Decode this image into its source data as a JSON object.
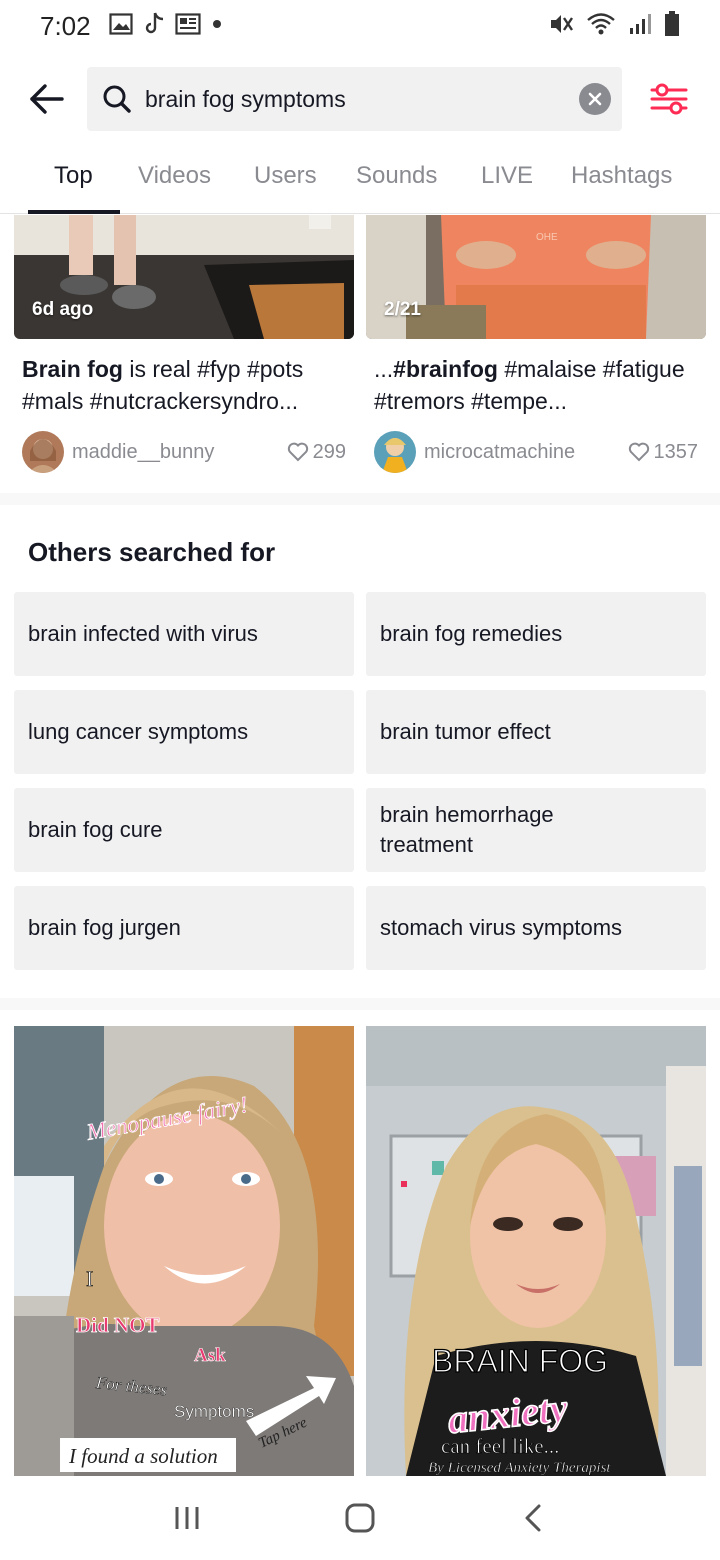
{
  "status_bar": {
    "time": "7:02"
  },
  "search": {
    "query": "brain fog symptoms"
  },
  "tabs": [
    {
      "label": "Top",
      "active": true
    },
    {
      "label": "Videos",
      "active": false
    },
    {
      "label": "Users",
      "active": false
    },
    {
      "label": "Sounds",
      "active": false
    },
    {
      "label": "LIVE",
      "active": false
    },
    {
      "label": "Hashtags",
      "active": false
    }
  ],
  "top_videos": [
    {
      "thumb_label": "6d ago",
      "caption_bold": "Brain fog",
      "caption_rest": " is real #fyp #pots #mals #nutcrackersyndro...",
      "username": "maddie__bunny",
      "likes": "299"
    },
    {
      "thumb_label": "2/21",
      "caption_prefix": "...",
      "caption_bold": "#brainfog",
      "caption_rest": " #malaise #fatigue #tremors #tempe...",
      "username": "microcatmachine",
      "likes": "1357"
    }
  ],
  "others_searched": {
    "title": "Others searched for",
    "items": [
      "brain infected with virus",
      "brain fog remedies",
      "lung cancer symptoms",
      "brain tumor effect",
      "brain fog cure",
      "brain hemorrhage treatment",
      "brain fog jurgen",
      "stomach virus symptoms"
    ]
  },
  "bottom_videos": [
    {
      "overlay_texts": {
        "title": "Menopause fairy!",
        "i": "I",
        "did_not": "Did NOT",
        "ask": "Ask",
        "for_these": "For theses",
        "symptoms": "Symptoms",
        "tap_here": "Tap here",
        "solution": "I found a solution"
      }
    },
    {
      "overlay_texts": {
        "brain_fog": "BRAIN FOG",
        "anxiety": "anxiety",
        "can_feel": "can feel like...",
        "by": "By Licensed Anxiety Therapist"
      }
    }
  ],
  "icons": {
    "status_left": [
      "gallery-icon",
      "tiktok-icon",
      "news-icon",
      "dot-icon"
    ],
    "status_right": [
      "mute-icon",
      "wifi-icon",
      "signal-icon",
      "battery-icon"
    ]
  },
  "colors": {
    "accent": "#fe2c55",
    "tab_inactive": "#8a8b91",
    "suggestion_bg": "#f1f1f2"
  }
}
